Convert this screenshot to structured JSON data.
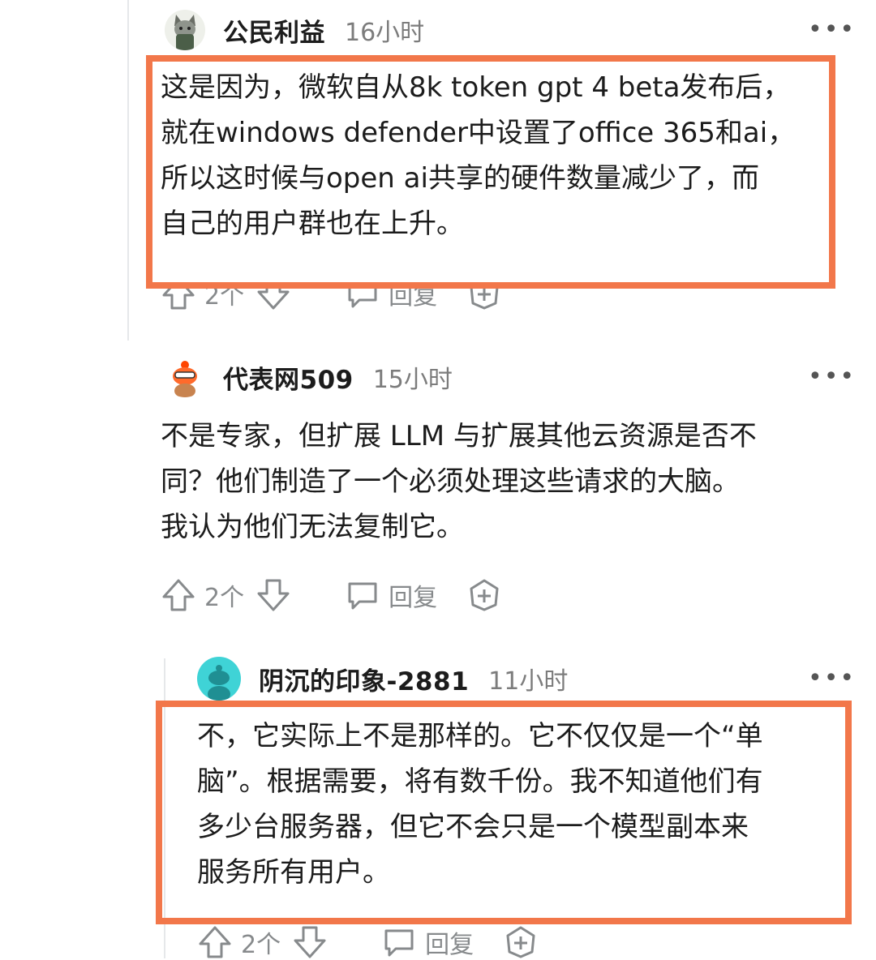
{
  "highlight_color": "#f2774a",
  "comments": [
    {
      "username": "公民利益",
      "time": "16小时",
      "avatar_icon": "wolf-knight-avatar-icon",
      "lines": [
        "这是因为，微软自从8k token gpt 4 beta发布后，",
        "就在windows defender中设置了office 365和ai，",
        "所以这时候与open ai共享的硬件数量减少了，而",
        "自己的用户群也在上升。"
      ],
      "votes": "2个",
      "reply_label": "回复"
    },
    {
      "username": "代表网509",
      "time": "15小时",
      "avatar_icon": "orange-snoo-avatar-icon",
      "lines": [
        "不是专家，但扩展 LLM 与扩展其他云资源是否不",
        "同？他们制造了一个必须处理这些请求的大脑。",
        "我认为他们无法复制它。"
      ],
      "votes": "2个",
      "reply_label": "回复"
    },
    {
      "username": "阴沉的印象-2881",
      "time": "11小时",
      "avatar_icon": "teal-snoo-avatar-icon",
      "lines": [
        "不，它实际上不是那样的。它不仅仅是一个“单",
        "脑”。根据需要，将有数千份。我不知道他们有",
        "多少台服务器，但它不会只是一个模型副本来",
        "服务所有用户。"
      ],
      "votes": "2个",
      "reply_label": "回复"
    }
  ]
}
